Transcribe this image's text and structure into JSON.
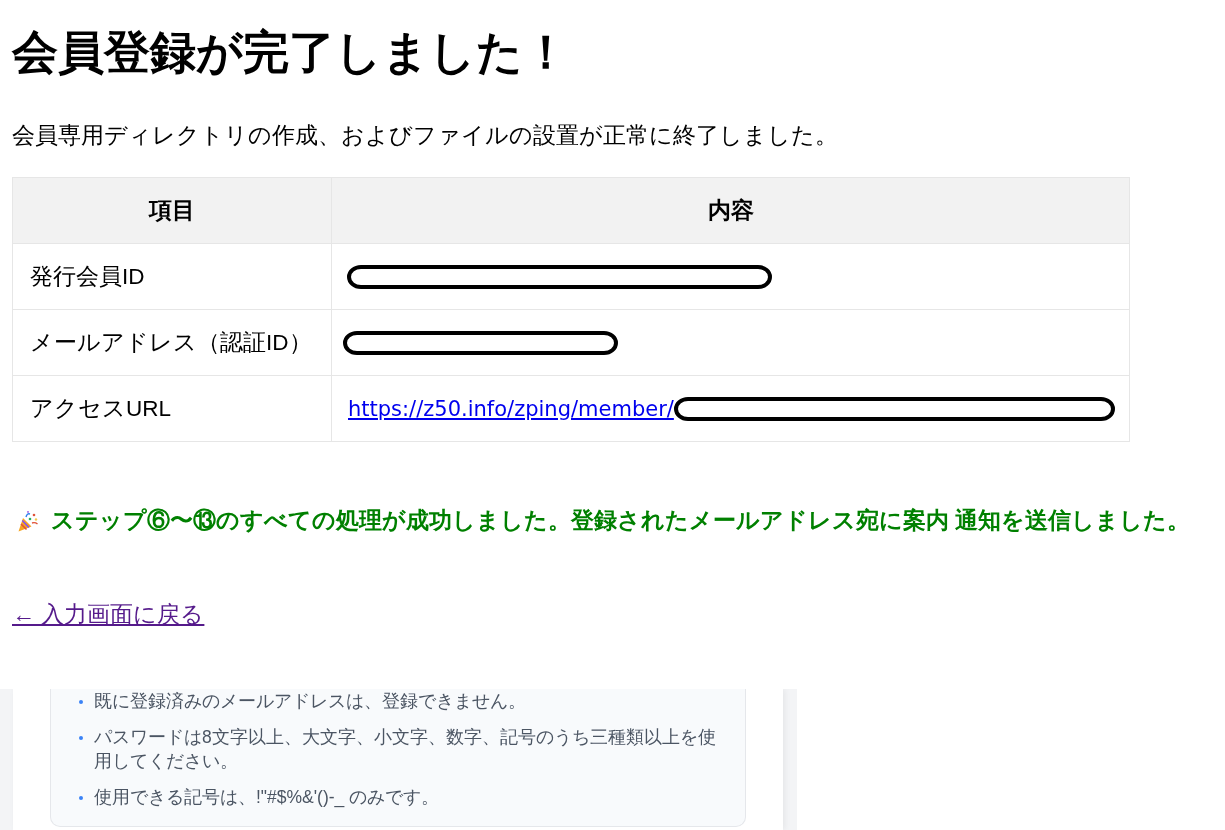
{
  "heading": "会員登録が完了しました！",
  "description": "会員専用ディレクトリの作成、およびファイルの設置が正常に終了しました。",
  "table": {
    "columns": [
      "項目",
      "内容"
    ],
    "rows": [
      {
        "item": "発行会員ID",
        "redacted": true
      },
      {
        "item": "メールアドレス（認証ID）",
        "redacted": true
      },
      {
        "item": "アクセスURL",
        "link": {
          "text": "https://z50.info/zping/member/",
          "visited": false
        },
        "redacted": true
      }
    ]
  },
  "success_message": "ステップ⑥〜⑬のすべての処理が成功しました。登録されたメールアドレス宛に案内 通知を送信しました。",
  "back_link": {
    "text": "← 入力画面に戻る",
    "visited": true
  },
  "notes": [
    "既に登録済みのメールアドレスは、登録できません。",
    "パスワードは8文字以上、大文字、小文字、数字、記号のうち三種類以上を使用してください。",
    "使用できる記号は、!\"#$%&'()-_ のみです。"
  ]
}
